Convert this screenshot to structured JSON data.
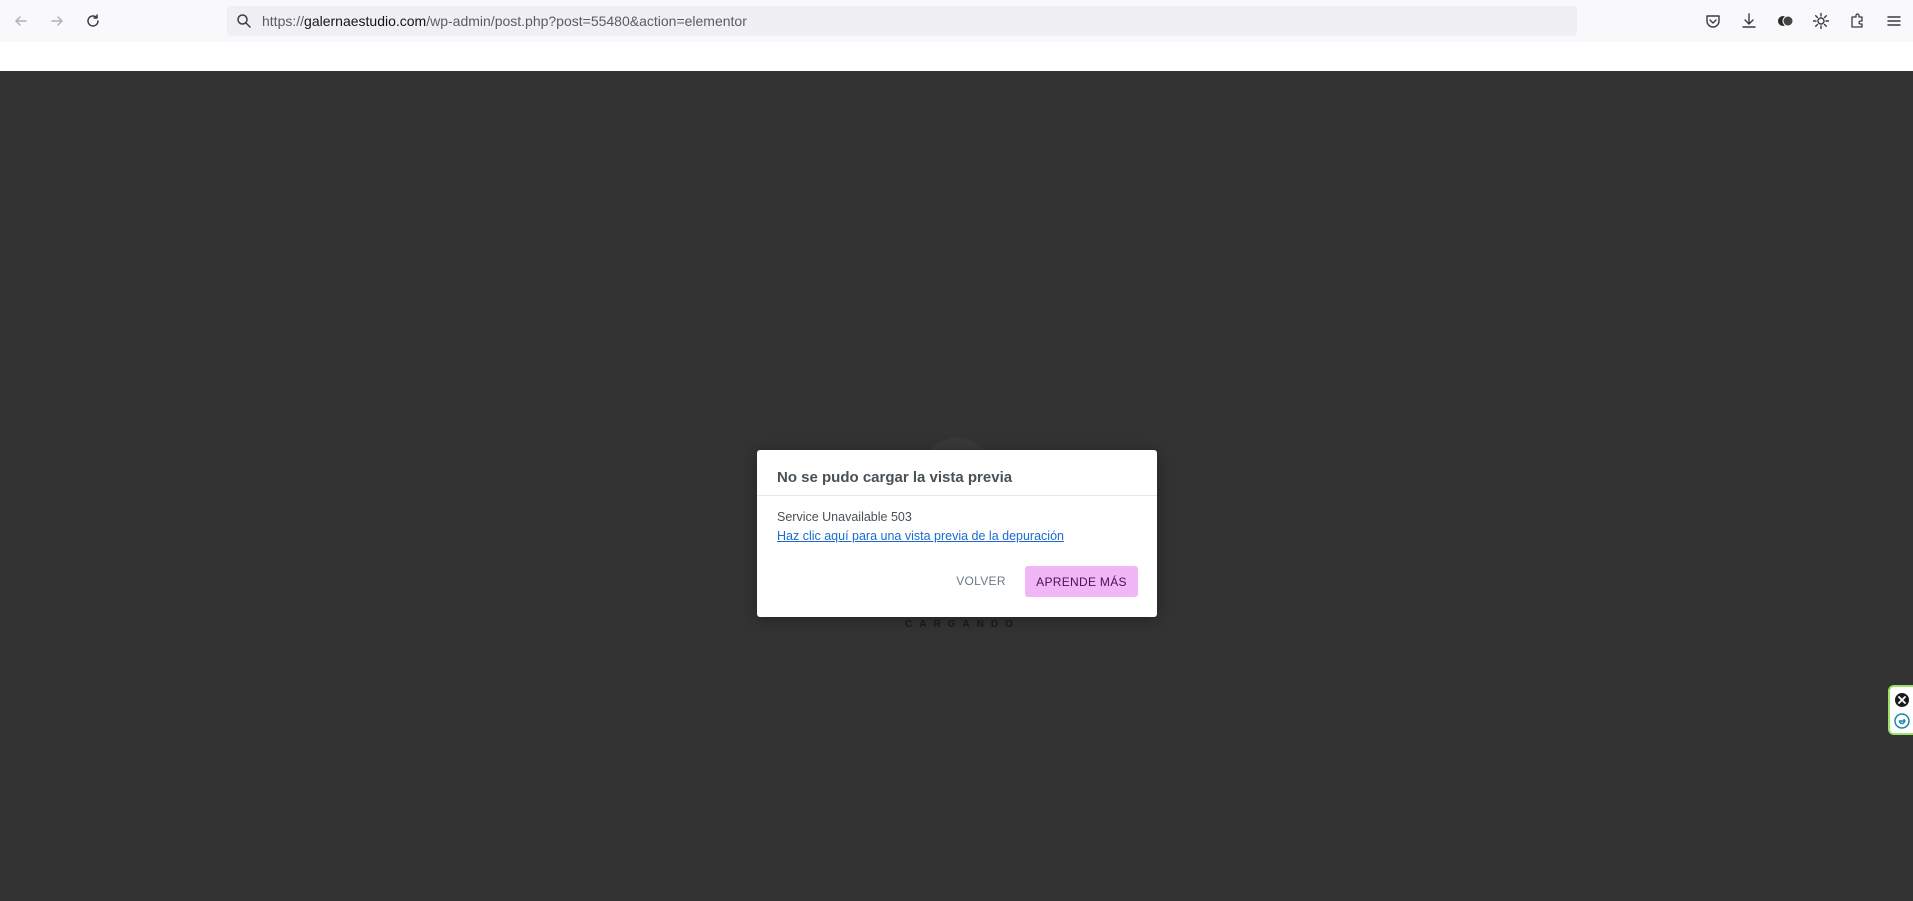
{
  "browser": {
    "url_prefix": "https://",
    "url_host": "galernaestudio.com",
    "url_path": "/wp-admin/post.php?post=55480&action=elementor",
    "icons": [
      "back-icon",
      "forward-icon",
      "reload-icon",
      "search-icon",
      "pocket-icon",
      "download-icon",
      "extensions-icon",
      "settings-icon",
      "puzzle-icon",
      "menu-icon"
    ]
  },
  "editor": {
    "loading_text": "CARGANDO"
  },
  "dialog": {
    "title": "No se pudo cargar la vista previa",
    "message": "Service Unavailable 503",
    "debug_link": "Haz clic aquí para una vista previa de la depuración",
    "back_button": "VOLVER",
    "learn_more_button": "APRENDE MÁS"
  },
  "colors": {
    "canvas": "#333333",
    "learn_more_bg": "#f0b6f5",
    "link": "#1a6bd0",
    "widget_border": "#9be26a"
  }
}
